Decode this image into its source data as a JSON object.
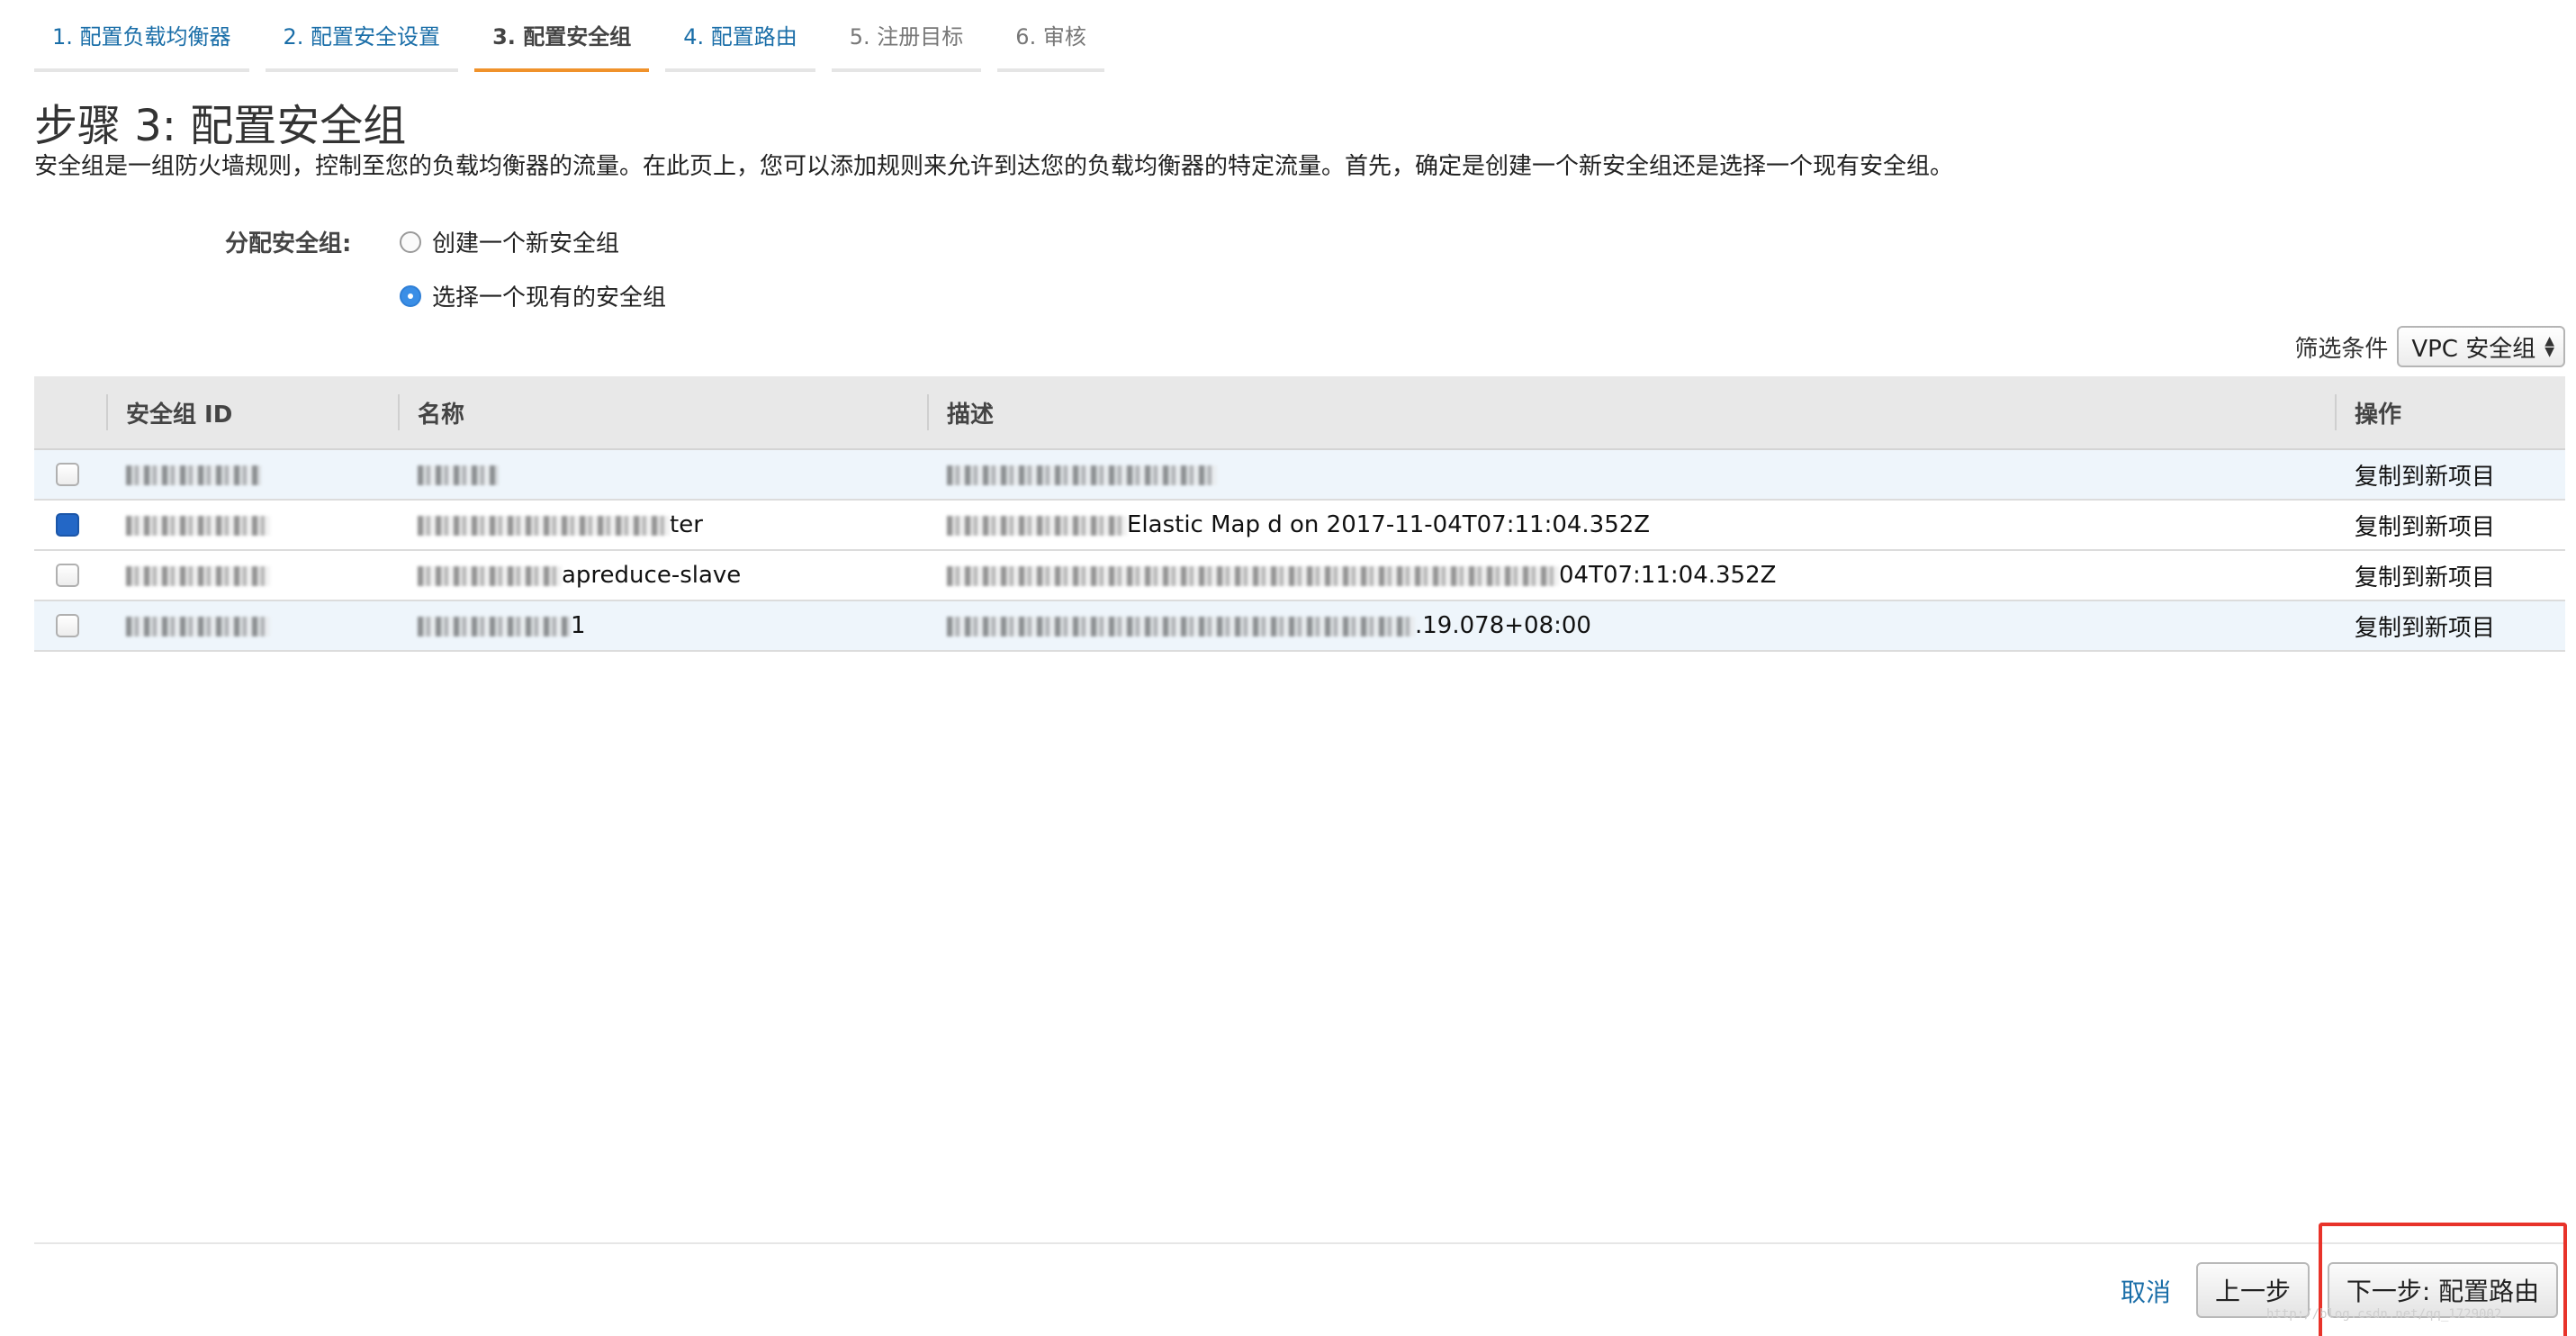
{
  "wizard": {
    "steps": [
      {
        "label": "1. 配置负载均衡器",
        "state": "done"
      },
      {
        "label": "2. 配置安全设置",
        "state": "done"
      },
      {
        "label": "3. 配置安全组",
        "state": "active"
      },
      {
        "label": "4. 配置路由",
        "state": "done"
      },
      {
        "label": "5. 注册目标",
        "state": "todo"
      },
      {
        "label": "6. 审核",
        "state": "todo"
      }
    ]
  },
  "page": {
    "title": "步骤 3: 配置安全组",
    "description": "安全组是一组防火墙规则，控制至您的负载均衡器的流量。在此页上，您可以添加规则来允许到达您的负载均衡器的特定流量。首先，确定是创建一个新安全组还是选择一个现有安全组。"
  },
  "assign": {
    "label": "分配安全组:",
    "options": [
      {
        "label": "创建一个新安全组",
        "checked": false
      },
      {
        "label": "选择一个现有的安全组",
        "checked": true
      }
    ]
  },
  "filter": {
    "label": "筛选条件",
    "selected": "VPC 安全组"
  },
  "table": {
    "headers": {
      "id": "安全组 ID",
      "name": "名称",
      "desc": "描述",
      "action": "操作"
    },
    "rows": [
      {
        "checked": false,
        "name_suffix": "",
        "desc_suffix": "",
        "action": "复制到新项目"
      },
      {
        "checked": true,
        "name_suffix": "ter",
        "desc_suffix": "Elastic Map        d on 2017-11-04T07:11:04.352Z",
        "action": "复制到新项目"
      },
      {
        "checked": false,
        "name_suffix": "apreduce-slave",
        "desc_suffix": "04T07:11:04.352Z",
        "action": "复制到新项目"
      },
      {
        "checked": false,
        "name_suffix": "1",
        "desc_suffix": ".19.078+08:00",
        "action": "复制到新项目"
      }
    ]
  },
  "footer": {
    "cancel": "取消",
    "prev": "上一步",
    "next": "下一步: 配置路由",
    "watermark": "http://blog.csdn.net/qq_1729002"
  }
}
